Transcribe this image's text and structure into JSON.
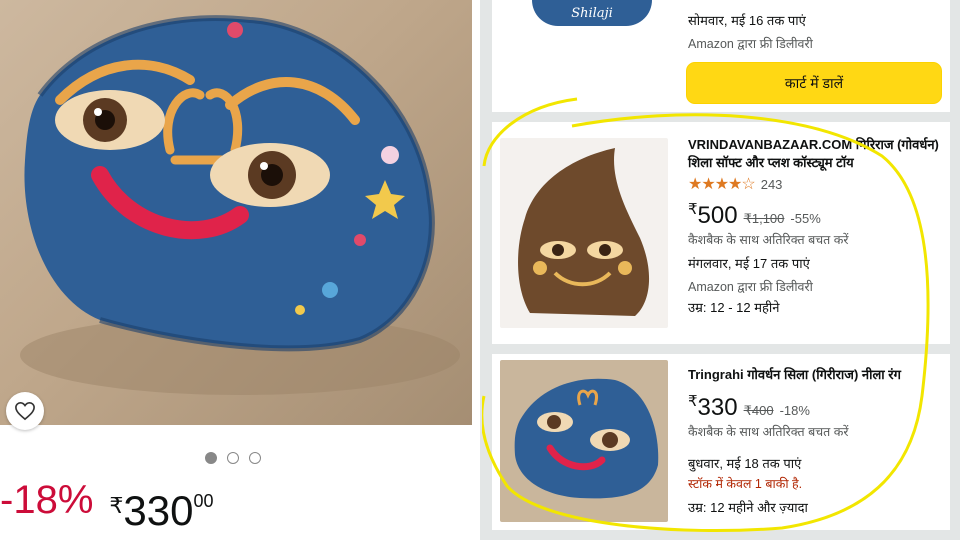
{
  "product": {
    "discount": "-18%",
    "price_symbol": "₹",
    "price_whole": "330",
    "price_fraction": "00",
    "image_icon": "stone-face-image",
    "carousel": {
      "count": 3,
      "active": 0
    }
  },
  "top_card": {
    "delivery": "सोमवार, मई 16 तक पाएं",
    "shipping": "Amazon द्वारा फ्री डिलीवरी",
    "cart_label": "कार्ट में डालें",
    "thumb_text": "Shilaji"
  },
  "cards": [
    {
      "title": "VRINDAVANBAZAAR.COM गिरिराज (गोवर्धन) शिला सॉफ्ट और प्लश कॉस्ट्यूम टॉय",
      "stars": "★★★★☆",
      "rating_count": "243",
      "price_symbol": "₹",
      "price": "500",
      "mrp": "₹1,100",
      "discount": "-55%",
      "cashback": "कैशबैक के साथ अतिरिक्त बचत करें",
      "delivery": "मंगलवार, मई 17 तक पाएं",
      "shipping": "Amazon द्वारा फ्री डिलीवरी",
      "age": "उम्र: 12 - 12 महीने"
    },
    {
      "title": "Tringrahi गोवर्धन सिला (गिरीराज) नीला रंग",
      "price_symbol": "₹",
      "price": "330",
      "mrp": "₹400",
      "discount": "-18%",
      "cashback": "कैशबैक के साथ अतिरिक्त बचत करें",
      "delivery": "बुधवार, मई 18 तक पाएं",
      "stock": "स्टॉक में केवल 1 बाकी है.",
      "age": "उम्र: 12 महीने और ज़्यादा"
    }
  ],
  "colors": {
    "accent_yellow": "#ffd814",
    "deal_red": "#cc0c39",
    "star_orange": "#de7921",
    "highlight": "#f2e600"
  }
}
